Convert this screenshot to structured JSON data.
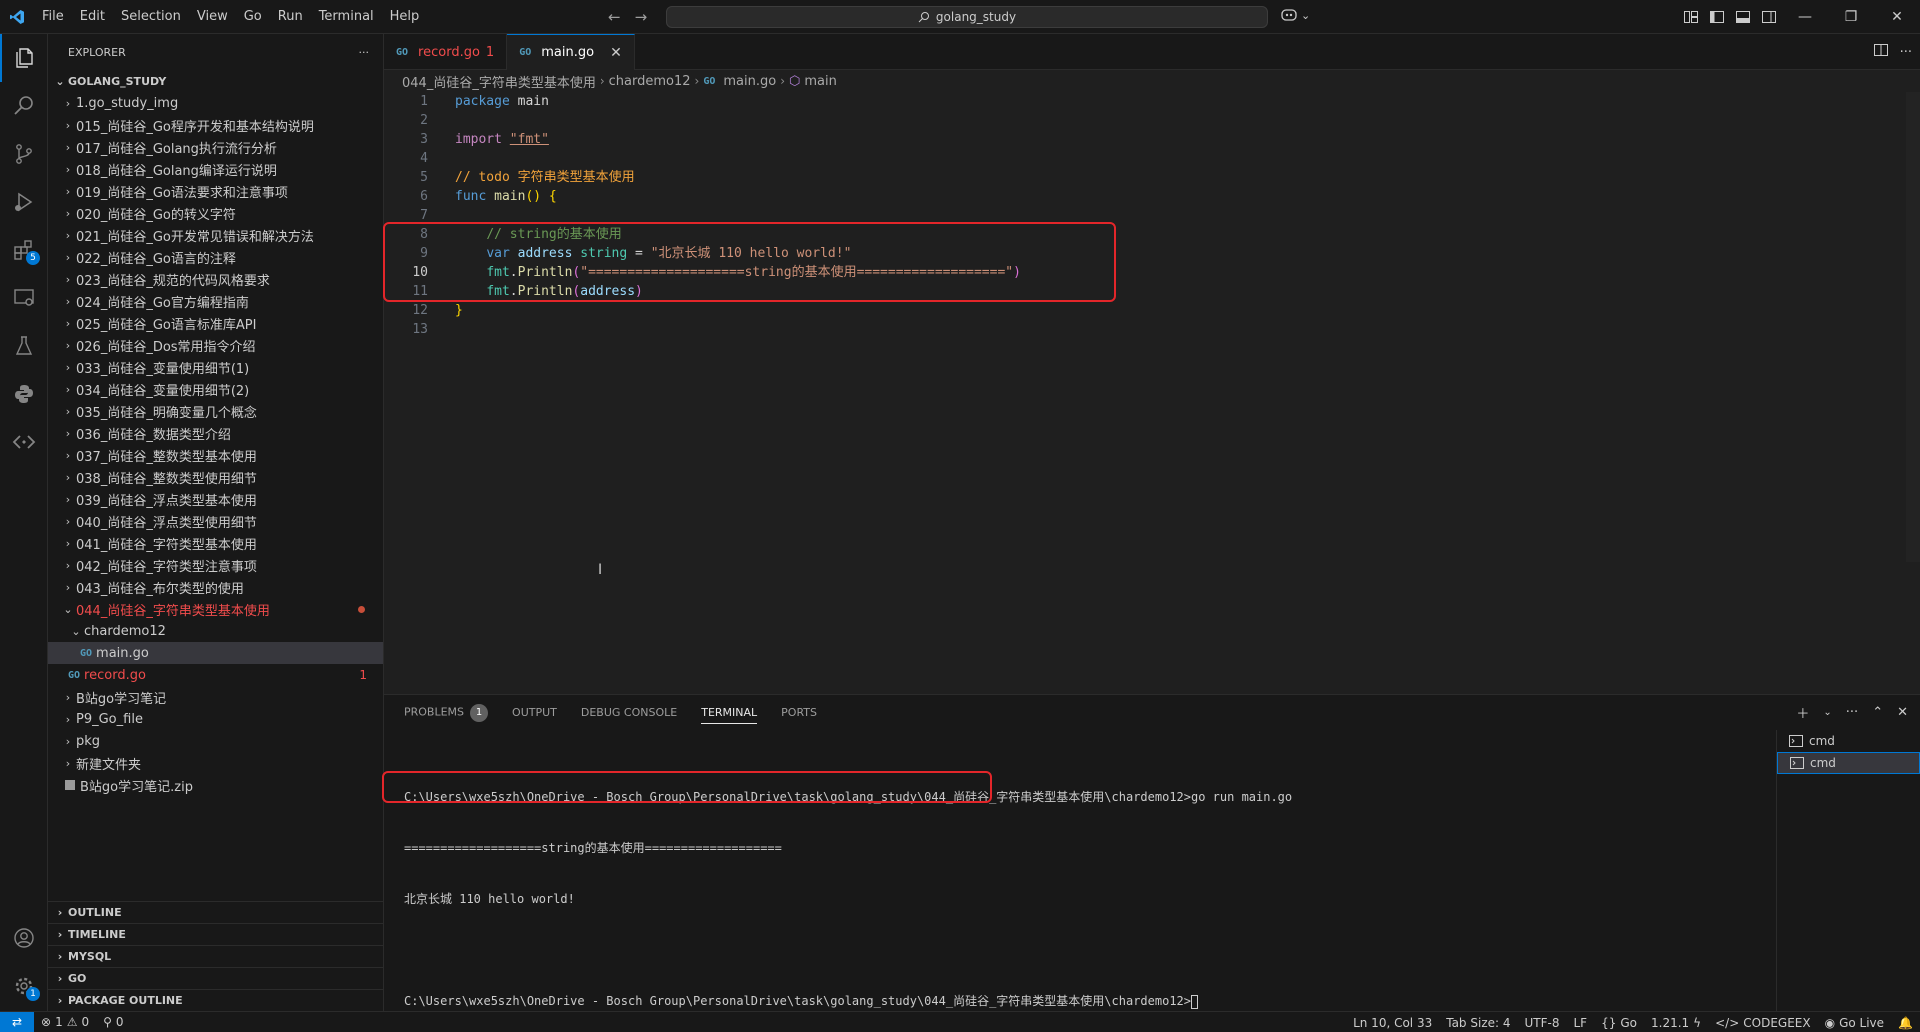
{
  "menu": [
    "File",
    "Edit",
    "Selection",
    "View",
    "Go",
    "Run",
    "Terminal",
    "Help"
  ],
  "search": {
    "label": "golang_study"
  },
  "explorer": {
    "title": "EXPLORER",
    "root": "GOLANG_STUDY",
    "items": [
      "1.go_study_img",
      "015_尚硅谷_Go程序开发和基本结构说明",
      "017_尚硅谷_Golang执行流行分析",
      "018_尚硅谷_Golang编译运行说明",
      "019_尚硅谷_Go语法要求和注意事项",
      "020_尚硅谷_Go的转义字符",
      "021_尚硅谷_Go开发常见错误和解决方法",
      "022_尚硅谷_Go语言的注释",
      "023_尚硅谷_规范的代码风格要求",
      "024_尚硅谷_Go官方编程指南",
      "025_尚硅谷_Go语言标准库API",
      "026_尚硅谷_Dos常用指令介绍",
      "033_尚硅谷_变量使用细节(1)",
      "034_尚硅谷_变量使用细节(2)",
      "035_尚硅谷_明确变量几个概念",
      "036_尚硅谷_数据类型介绍",
      "037_尚硅谷_整数类型基本使用",
      "038_尚硅谷_整数类型使用细节",
      "039_尚硅谷_浮点类型基本使用",
      "040_尚硅谷_浮点类型使用细节",
      "041_尚硅谷_字符类型基本使用",
      "042_尚硅谷_字符类型注意事项",
      "043_尚硅谷_布尔类型的使用"
    ],
    "open_folder": "044_尚硅谷_字符串类型基本使用",
    "sub_folder": "chardemo12",
    "selected_file": "main.go",
    "record_file": "record.go",
    "record_errors": "1",
    "after_items": [
      "B站go学习笔记",
      "P9_Go_file",
      "pkg",
      "新建文件夹"
    ],
    "zip_file": "B站go学习笔记.zip",
    "sections": [
      "OUTLINE",
      "TIMELINE",
      "MYSQL",
      "GO",
      "PACKAGE OUTLINE"
    ]
  },
  "tabs": [
    {
      "label": "record.go",
      "suffix": "1"
    },
    {
      "label": "main.go"
    }
  ],
  "breadcrumb": [
    "044_尚硅谷_字符串类型基本使用",
    "chardemo12",
    "main.go",
    "main"
  ],
  "code": {
    "line_numbers": [
      "1",
      "2",
      "3",
      "4",
      "5",
      "6",
      "7",
      "8",
      "9",
      "10",
      "11",
      "12",
      "13"
    ],
    "current_line": "10",
    "l1_kw": "package",
    "l1_name": "main",
    "l3_kw": "import",
    "l3_str": "\"fmt\"",
    "l5_comment": "// todo 字符串类型基本使用",
    "l6_kw": "func",
    "l6_name": "main",
    "l6_rest": "() {",
    "l8_comment": "// string的基本使用",
    "l9_kw": "var",
    "l9_name": "address",
    "l9_type": "string",
    "l9_eq": " = ",
    "l9_str": "\"北京长城 110 hello world!\"",
    "l10_pkg": "fmt",
    "l10_fn": "Println",
    "l10_str": "\"====================string的基本使用===================\"",
    "l11_pkg": "fmt",
    "l11_fn": "Println",
    "l11_arg": "address",
    "l12": "}"
  },
  "panel": {
    "tabs": [
      "PROBLEMS",
      "OUTPUT",
      "DEBUG CONSOLE",
      "TERMINAL",
      "PORTS"
    ],
    "problems_count": "1",
    "terminal_lines": [
      "C:\\Users\\wxe5szh\\OneDrive - Bosch Group\\PersonalDrive\\task\\golang_study\\044_尚硅谷_字符串类型基本使用\\chardemo12>go run main.go",
      "===================string的基本使用===================",
      "北京长城 110 hello world!",
      "",
      "C:\\Users\\wxe5szh\\OneDrive - Bosch Group\\PersonalDrive\\task\\golang_study\\044_尚硅谷_字符串类型基本使用\\chardemo12>"
    ],
    "terminals": [
      "cmd",
      "cmd"
    ]
  },
  "status": {
    "errors": "1",
    "warnings": "0",
    "ports": "0",
    "position": "Ln 10, Col 33",
    "tab_size": "Tab Size: 4",
    "encoding": "UTF-8",
    "eol": "LF",
    "language": "Go",
    "go_version": "1.21.1",
    "codegeex": "CODEGEEX",
    "go_live": "Go Live"
  },
  "colors": {
    "accent": "#0078d4",
    "error": "#f14c4c",
    "highlight_box": "#e3262a"
  }
}
